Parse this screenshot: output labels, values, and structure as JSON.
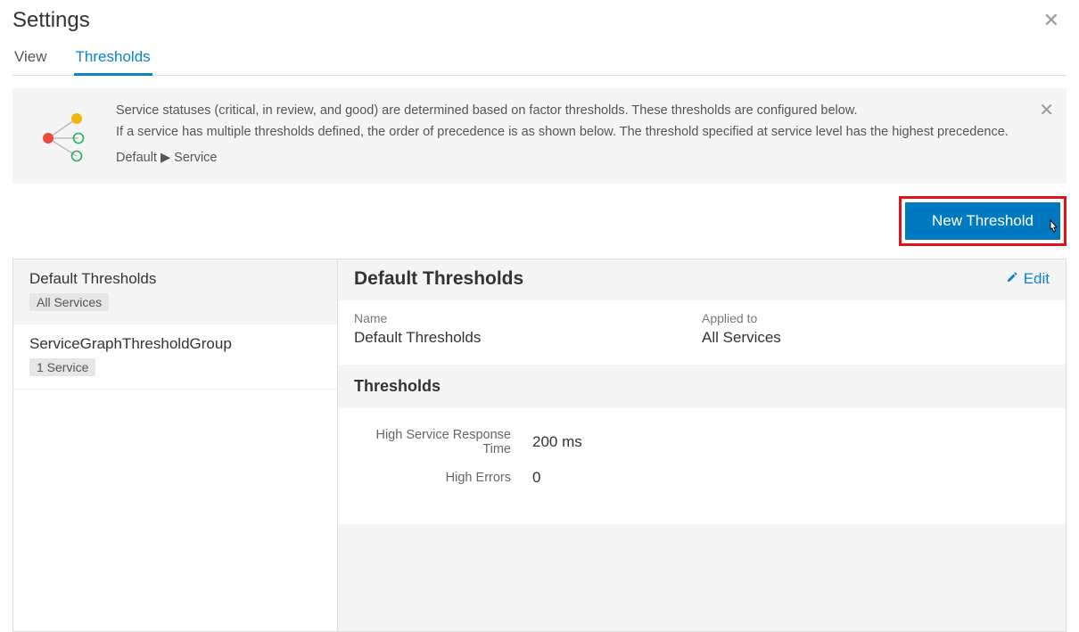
{
  "header": {
    "title": "Settings"
  },
  "tabs": {
    "view": "View",
    "thresholds": "Thresholds"
  },
  "info": {
    "line1": "Service statuses (critical, in review, and good) are determined based on factor thresholds. These thresholds are configured below.",
    "line2": "If a service has multiple thresholds defined, the order of precedence is as shown below. The threshold specified at service level has the highest precedence.",
    "precedence": "Default ▶ Service"
  },
  "actions": {
    "new_threshold": "New Threshold",
    "edit": "Edit"
  },
  "sidebar": {
    "items": [
      {
        "title": "Default Thresholds",
        "badge": "All Services"
      },
      {
        "title": "ServiceGraphThresholdGroup",
        "badge": "1 Service"
      }
    ]
  },
  "detail": {
    "title": "Default Thresholds",
    "meta": {
      "name_label": "Name",
      "name_value": "Default Thresholds",
      "applied_label": "Applied to",
      "applied_value": "All Services"
    },
    "section_label": "Thresholds",
    "thresholds": [
      {
        "label": "High Service Response Time",
        "value": "200 ms"
      },
      {
        "label": "High Errors",
        "value": "0"
      }
    ]
  }
}
